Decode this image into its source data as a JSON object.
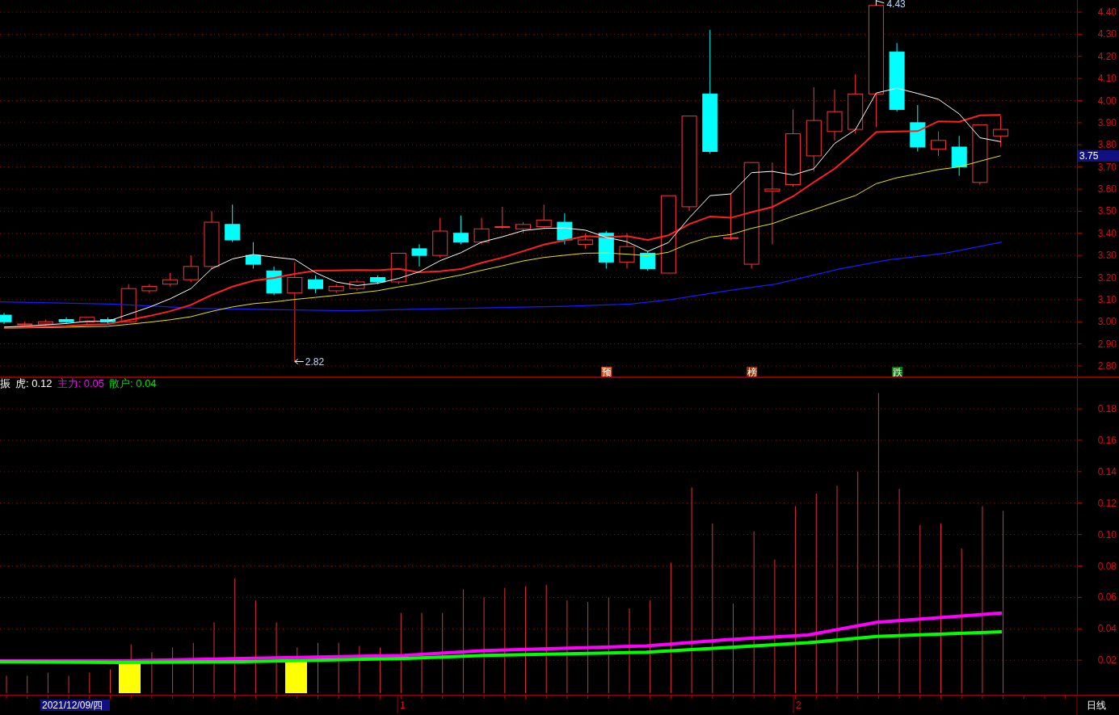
{
  "price_axis": {
    "labels": [
      "4.40",
      "4.30",
      "4.20",
      "4.10",
      "4.00",
      "3.90",
      "3.80",
      "3.70",
      "3.60",
      "3.50",
      "3.40",
      "3.30",
      "3.20",
      "3.10",
      "3.00",
      "2.90",
      "2.80"
    ],
    "current_price": "3.75"
  },
  "price_chart": {
    "high_label": "4.43",
    "low_label": "2.82",
    "signals": [
      {
        "label": "预",
        "color": "#c8501a"
      },
      {
        "label": "榜",
        "color": "#8c3c0c"
      },
      {
        "label": "跌",
        "color": "#0a7a0a"
      }
    ]
  },
  "indicator": {
    "name": "振",
    "legend": [
      {
        "label": "虎: 0.12",
        "color": "#ffffff"
      },
      {
        "label": "主力: 0.05",
        "color": "#ff00ff"
      },
      {
        "label": "散户: 0.04",
        "color": "#00e000"
      }
    ]
  },
  "indicator_axis": {
    "labels": [
      "0.18",
      "0.16",
      "0.14",
      "0.12",
      "0.10",
      "0.08",
      "0.06",
      "0.04",
      "0.02"
    ]
  },
  "time_axis": {
    "date": "2021/12/09/四",
    "marks": [
      "1",
      "2"
    ],
    "period": "日线"
  }
}
